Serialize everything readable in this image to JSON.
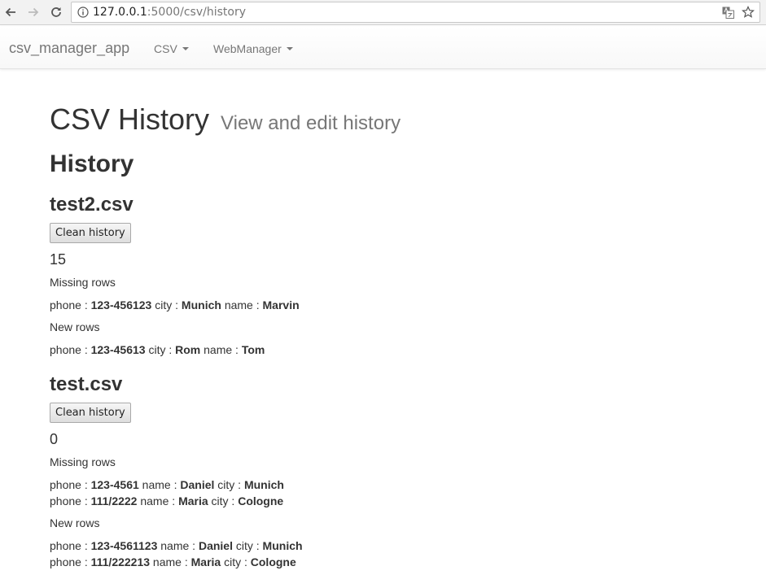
{
  "browser": {
    "url_host": "127.0.0.1",
    "url_path": ":5000/csv/history"
  },
  "navbar": {
    "brand": "csv_manager_app",
    "menus": [
      {
        "label": "CSV"
      },
      {
        "label": "WebManager"
      }
    ]
  },
  "page": {
    "title": "CSV History",
    "subtitle": "View and edit history",
    "section_heading": "History"
  },
  "files": [
    {
      "name": "test2.csv",
      "clean_label": "Clean history",
      "count": "15",
      "missing_label": "Missing rows",
      "missing_rows": [
        [
          {
            "key": "phone",
            "value": "123-456123"
          },
          {
            "key": "city",
            "value": "Munich"
          },
          {
            "key": "name",
            "value": "Marvin"
          }
        ]
      ],
      "new_label": "New rows",
      "new_rows": [
        [
          {
            "key": "phone",
            "value": "123-45613"
          },
          {
            "key": "city",
            "value": "Rom"
          },
          {
            "key": "name",
            "value": "Tom"
          }
        ]
      ]
    },
    {
      "name": "test.csv",
      "clean_label": "Clean history",
      "count": "0",
      "missing_label": "Missing rows",
      "missing_rows": [
        [
          {
            "key": "phone",
            "value": "123-4561"
          },
          {
            "key": "name",
            "value": "Daniel"
          },
          {
            "key": "city",
            "value": "Munich"
          }
        ],
        [
          {
            "key": "phone",
            "value": "111/2222"
          },
          {
            "key": "name",
            "value": "Maria"
          },
          {
            "key": "city",
            "value": "Cologne"
          }
        ]
      ],
      "new_label": "New rows",
      "new_rows": [
        [
          {
            "key": "phone",
            "value": "123-4561123"
          },
          {
            "key": "name",
            "value": "Daniel"
          },
          {
            "key": "city",
            "value": "Munich"
          }
        ],
        [
          {
            "key": "phone",
            "value": "111/222213"
          },
          {
            "key": "name",
            "value": "Maria"
          },
          {
            "key": "city",
            "value": "Cologne"
          }
        ]
      ]
    }
  ]
}
